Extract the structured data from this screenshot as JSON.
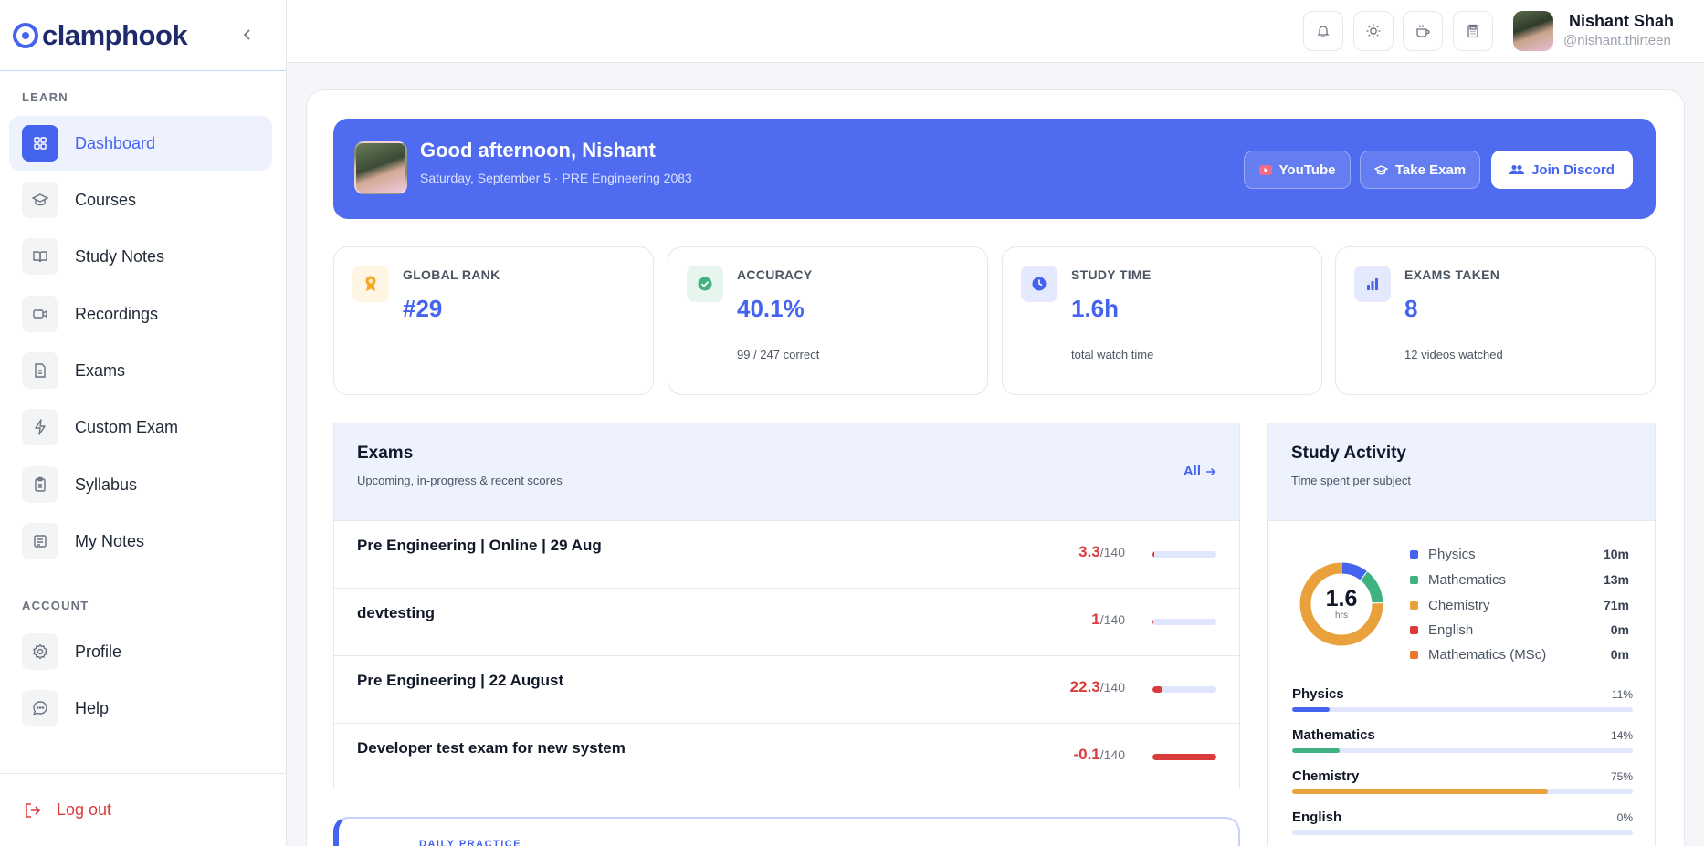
{
  "brand": {
    "name": "clamphook"
  },
  "sidebar": {
    "learn_label": "LEARN",
    "account_label": "ACCOUNT",
    "items": [
      {
        "label": "Dashboard",
        "icon": "grid-icon"
      },
      {
        "label": "Courses",
        "icon": "graduation-cap-icon"
      },
      {
        "label": "Study Notes",
        "icon": "book-open-icon"
      },
      {
        "label": "Recordings",
        "icon": "video-icon"
      },
      {
        "label": "Exams",
        "icon": "document-icon"
      },
      {
        "label": "Custom Exam",
        "icon": "lightning-icon"
      },
      {
        "label": "Syllabus",
        "icon": "clipboard-icon"
      },
      {
        "label": "My Notes",
        "icon": "notes-icon"
      }
    ],
    "account_items": [
      {
        "label": "Profile",
        "icon": "gear-icon"
      },
      {
        "label": "Help",
        "icon": "chat-icon"
      }
    ],
    "logout_label": "Log out"
  },
  "topbar": {
    "user_name": "Nishant Shah",
    "user_handle": "@nishant.thirteen"
  },
  "hero": {
    "greeting": "Good afternoon, Nishant",
    "subtitle": "Saturday, September 5 · PRE Engineering 2083",
    "youtube_label": "YouTube",
    "exam_label": "Take Exam",
    "discord_label": "Join Discord"
  },
  "stats": [
    {
      "label": "GLOBAL RANK",
      "value": "#29",
      "note": "",
      "color": "#f5a623"
    },
    {
      "label": "ACCURACY",
      "value": "40.1%",
      "note": "99 / 247 correct",
      "color": "#3fb27f"
    },
    {
      "label": "STUDY TIME",
      "value": "1.6h",
      "note": "total watch time",
      "color": "#4463ee"
    },
    {
      "label": "EXAMS TAKEN",
      "value": "8",
      "note": "12 videos watched",
      "color": "#4463ee"
    }
  ],
  "exams": {
    "title": "Exams",
    "subtitle": "Upcoming, in-progress & recent scores",
    "all_label": "All",
    "rows": [
      {
        "name": "Pre Engineering | Online | 29 Aug",
        "score": "3.3",
        "total": "/140",
        "progress": 0.024
      },
      {
        "name": "devtesting",
        "score": "1",
        "total": "/140",
        "progress": 0.007
      },
      {
        "name": "Pre Engineering | 22 August",
        "score": "22.3",
        "total": "/140",
        "progress": 0.159
      },
      {
        "name": "Developer test exam for new system",
        "score": "-0.1",
        "total": "/140",
        "progress": 1.0
      }
    ]
  },
  "activity": {
    "title": "Study Activity",
    "subtitle": "Time spent per subject",
    "total": "1.6",
    "total_unit": "hrs",
    "legend": [
      {
        "name": "Physics",
        "value": "10m",
        "minutes": 10,
        "color": "#4463ee"
      },
      {
        "name": "Mathematics",
        "value": "13m",
        "minutes": 13,
        "color": "#3fb27f"
      },
      {
        "name": "Chemistry",
        "value": "71m",
        "minutes": 71,
        "color": "#e9a23b"
      },
      {
        "name": "English",
        "value": "0m",
        "minutes": 0,
        "color": "#dc3b3b"
      },
      {
        "name": "Mathematics (MSc)",
        "value": "0m",
        "minutes": 0,
        "color": "#e8772e"
      }
    ],
    "bars": [
      {
        "name": "Physics",
        "pct": "11%",
        "fraction": 0.11,
        "color": "#4463ee"
      },
      {
        "name": "Mathematics",
        "pct": "14%",
        "fraction": 0.14,
        "color": "#3fb27f"
      },
      {
        "name": "Chemistry",
        "pct": "75%",
        "fraction": 0.75,
        "color": "#e9a23b"
      },
      {
        "name": "English",
        "pct": "0%",
        "fraction": 0.0,
        "color": "#dc3b3b"
      }
    ]
  },
  "daily": {
    "label": "DAILY PRACTICE"
  }
}
